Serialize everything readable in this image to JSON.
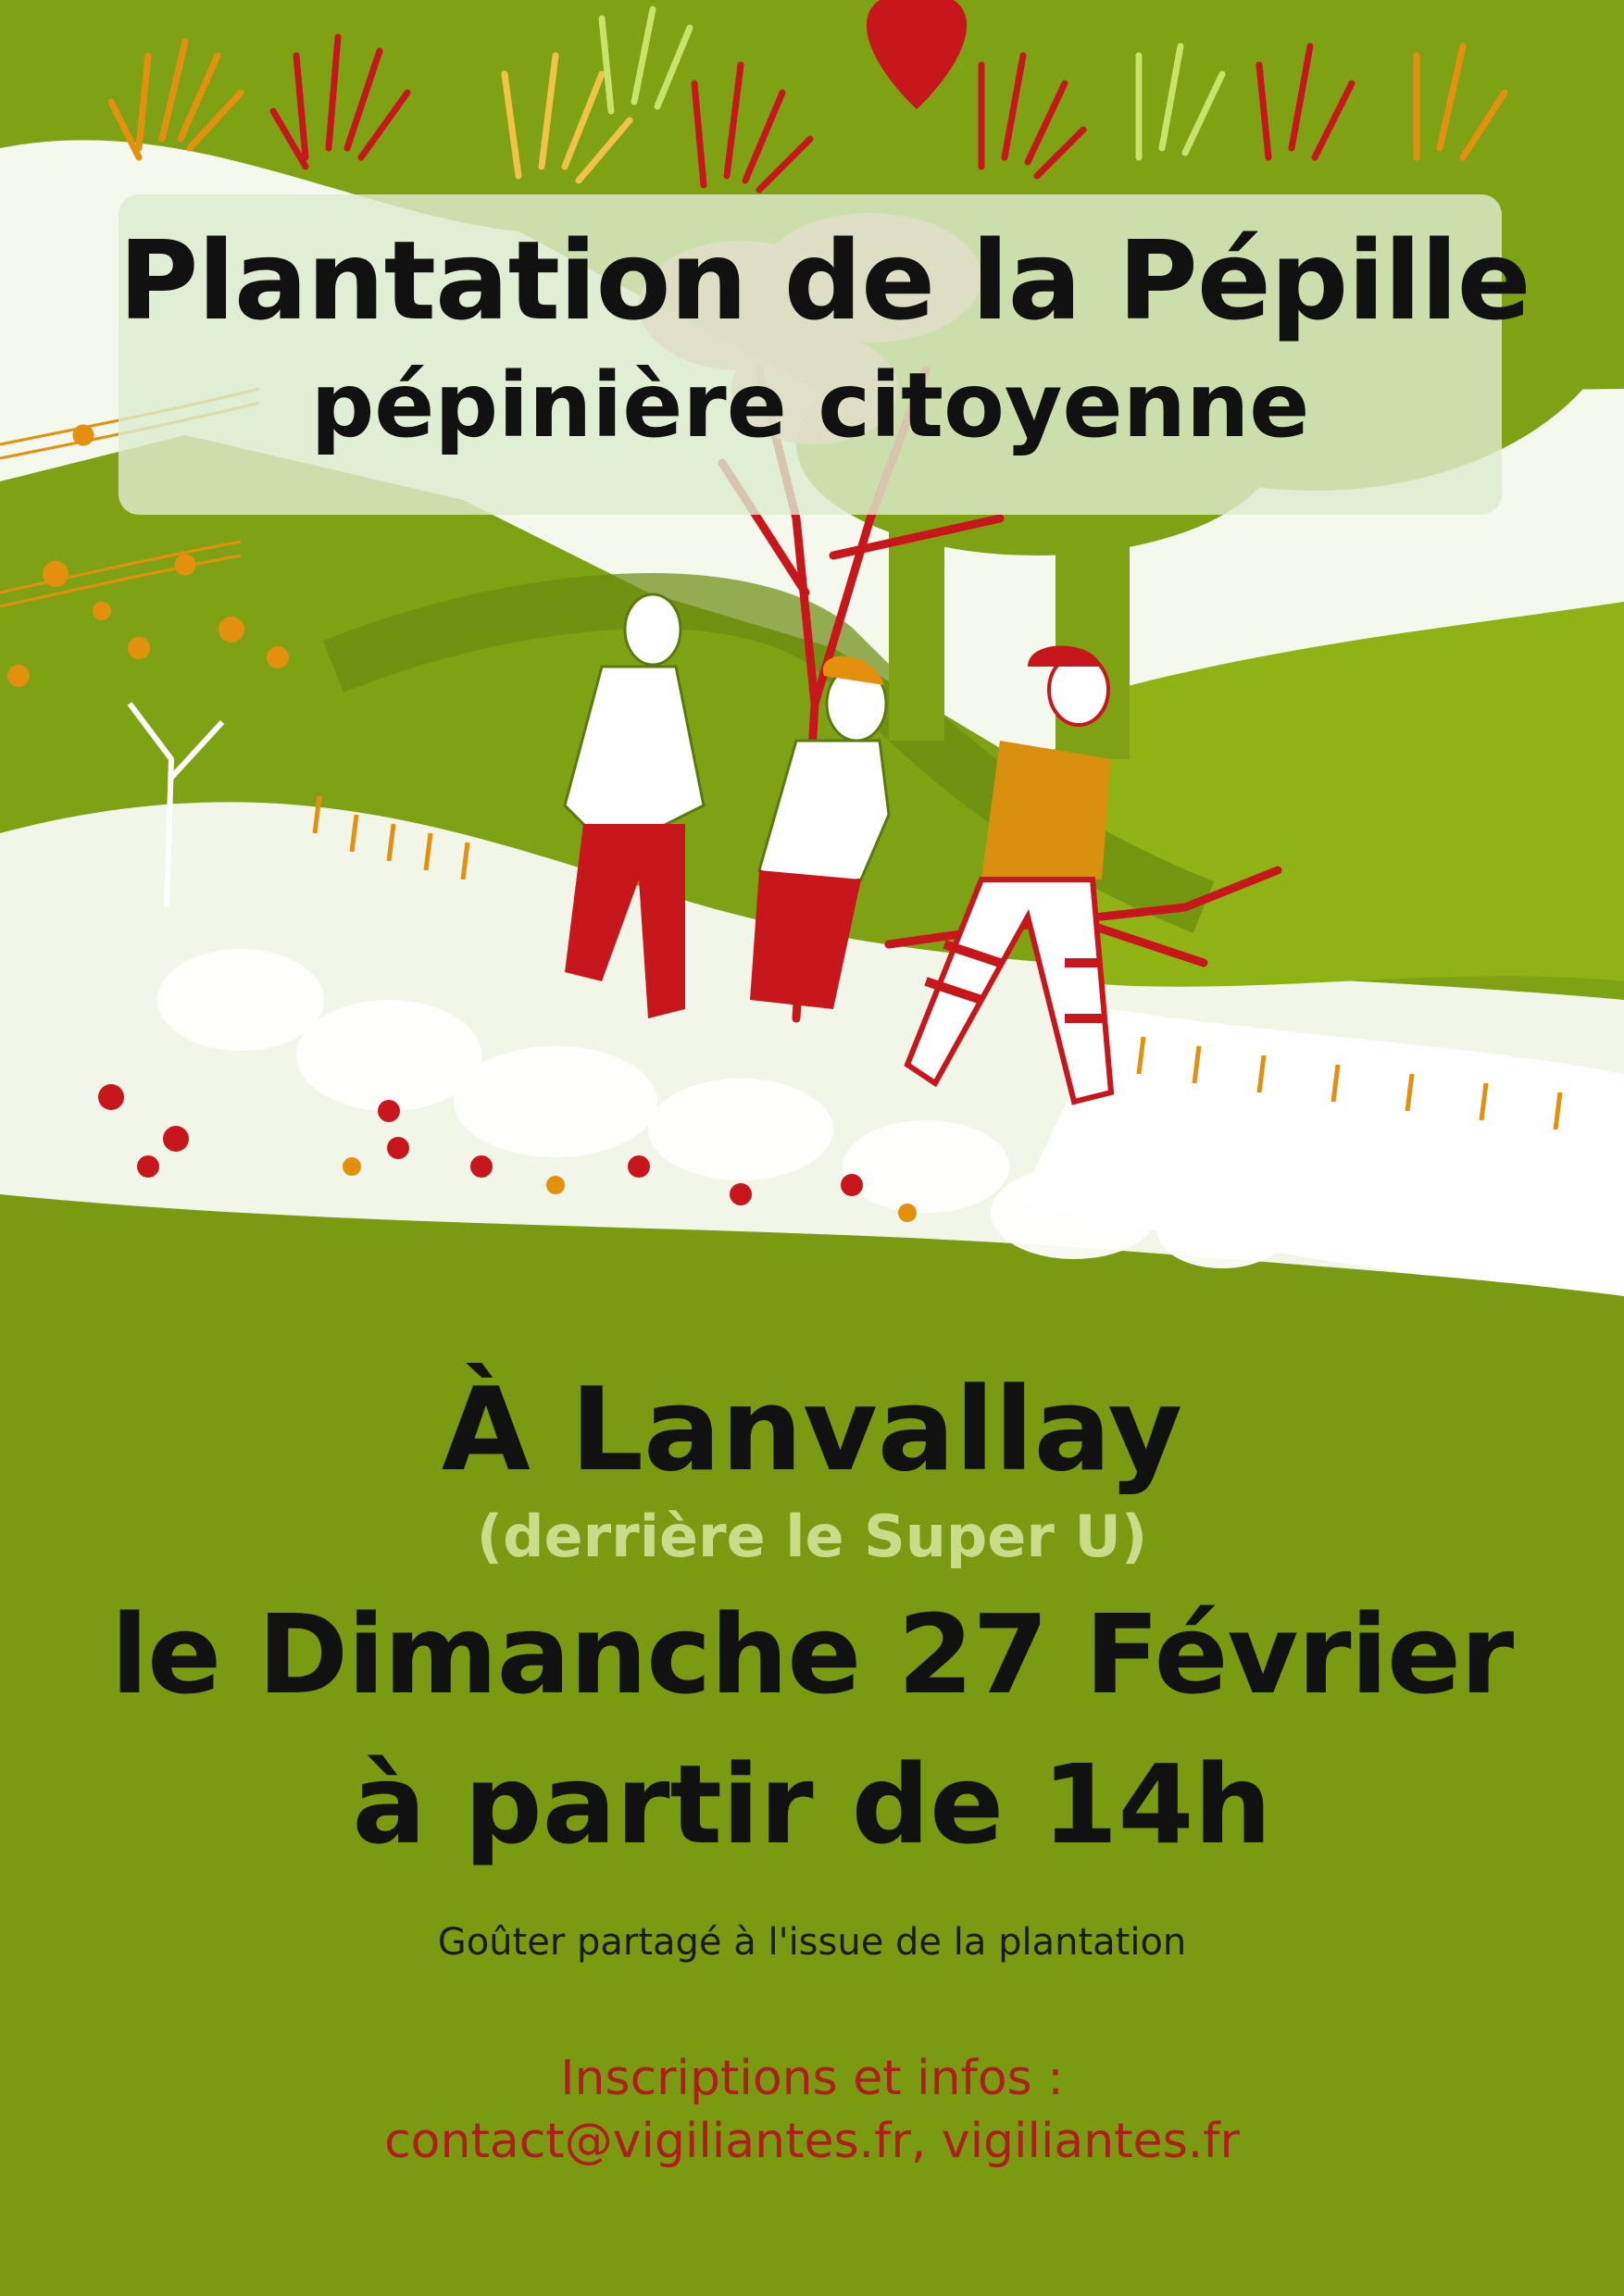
{
  "header": {
    "title": "Plantation de la Pépille",
    "subtitle": "pépinière citoyenne"
  },
  "event": {
    "location": "À Lanvallay",
    "location_note": "(derrière le Super U)",
    "date": "le Dimanche 27 Février",
    "time": "à partir de 14h",
    "snack": "Goûter partagé à l'issue de la plantation"
  },
  "contact": {
    "label": "Inscriptions et infos :",
    "line": "contact@vigiliantes.fr, vigiliantes.fr"
  },
  "colors": {
    "background": "#7a9a12",
    "accent_red": "#c8161d",
    "accent_orange": "#e3900f",
    "light_green": "#c8dc8a",
    "contact_text": "#b01d1d"
  },
  "illustration": {
    "icons": [
      "heart-icon",
      "hands-icon",
      "tree-icon",
      "person-icon",
      "plant-icon",
      "music-notes-icon"
    ]
  }
}
